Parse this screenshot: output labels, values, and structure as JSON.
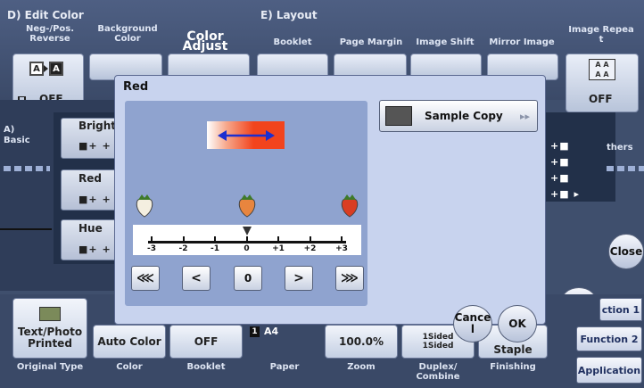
{
  "edit_color": {
    "title": "D)  Edit Color",
    "neg_pos": "Neg-/Pos.\nReverse",
    "background": "Background\nColor",
    "color_adjust": "Color Adjust",
    "neg_pos_value": "OFF"
  },
  "layout": {
    "title": "E)  Layout",
    "booklet": "Booklet",
    "page_margin": "Page Margin",
    "image_shift": "Image Shift",
    "mirror_image": "Mirror Image",
    "image_repeat": "Image Repea\nt",
    "image_repeat_value": "OFF"
  },
  "left_tabs": {
    "basic_line1": "A)",
    "basic_line2": "Basic"
  },
  "side_items": [
    {
      "label": "Brightn"
    },
    {
      "label": "Red"
    },
    {
      "label": "Hue"
    }
  ],
  "right_tabs": {
    "others": "thers",
    "close": "Close",
    "ok": "OK"
  },
  "dialog": {
    "title": "Red",
    "sample_copy": "Sample Copy",
    "scale_labels": [
      "-3",
      "-2",
      "-1",
      "0",
      "+1",
      "+2",
      "+3"
    ],
    "current_value": "0",
    "value_level": 0,
    "cancel": "Cance\nl",
    "ok": "OK"
  },
  "bottom": {
    "buttons": [
      {
        "label": "Text/Photo\nPrinted",
        "caption": "Original Type"
      },
      {
        "label": "Auto Color",
        "caption": "Color"
      },
      {
        "label": "OFF",
        "caption": "Booklet"
      },
      {
        "label": "A4",
        "caption": "Paper"
      },
      {
        "label": "100.0%",
        "caption": "Zoom"
      },
      {
        "label": "1Sided\n1Sided",
        "caption": "Duplex/\nCombine"
      },
      {
        "label": "Staple",
        "caption": "Finishing"
      }
    ],
    "paper_tray": "1",
    "functions": [
      "ction 1",
      "Function 2",
      "Application"
    ]
  },
  "colors": {
    "accent_red": "#f2441d",
    "arrow_blue": "#1c2fd0"
  }
}
